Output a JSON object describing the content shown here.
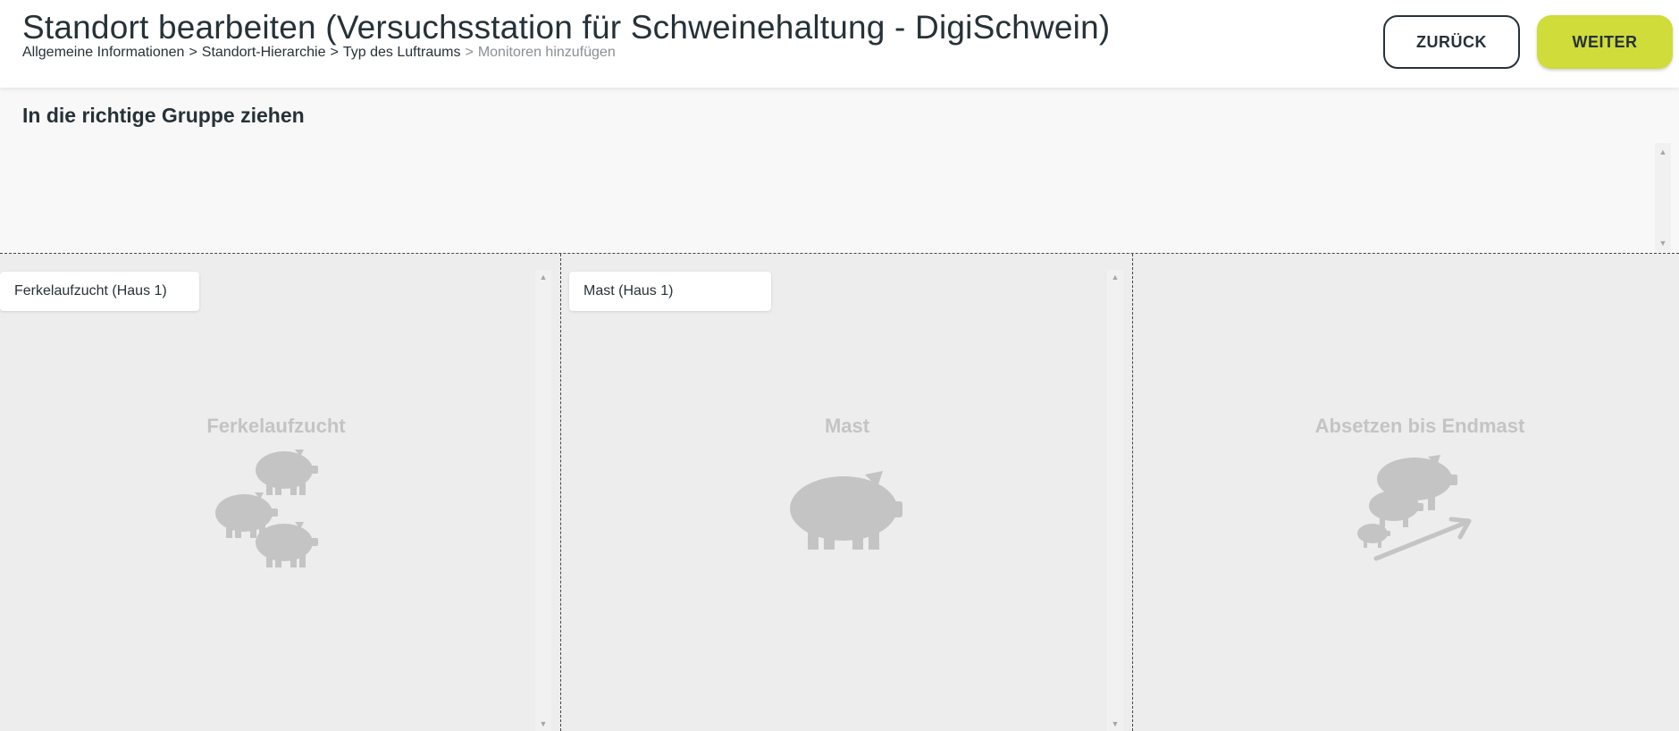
{
  "header": {
    "title": "Standort bearbeiten (Versuchsstation für Schweinehaltung - DigiSchwein)",
    "breadcrumb": {
      "step1": "Allgemeine Informationen",
      "step2": "Standort-Hierarchie",
      "step3": "Typ des Luftraums",
      "step4": "Monitoren hinzufügen",
      "separator": ">"
    },
    "back_label": "ZURÜCK",
    "next_label": "WEITER"
  },
  "pool": {
    "heading": "In die richtige Gruppe ziehen"
  },
  "groups": [
    {
      "label": "Ferkelaufzucht",
      "items": [
        "Ferkelaufzucht (Haus 1)"
      ],
      "icon": "piglets-icon"
    },
    {
      "label": "Mast",
      "items": [
        "Mast (Haus 1)"
      ],
      "icon": "pig-icon"
    },
    {
      "label": "Absetzen bis Endmast",
      "items": [],
      "icon": "pig-growth-icon"
    }
  ],
  "colors": {
    "accent": "#cfdc3a",
    "text": "#263238",
    "muted": "#8a8f93",
    "group_bg": "#ededed",
    "placeholder": "#c4c4c4"
  }
}
